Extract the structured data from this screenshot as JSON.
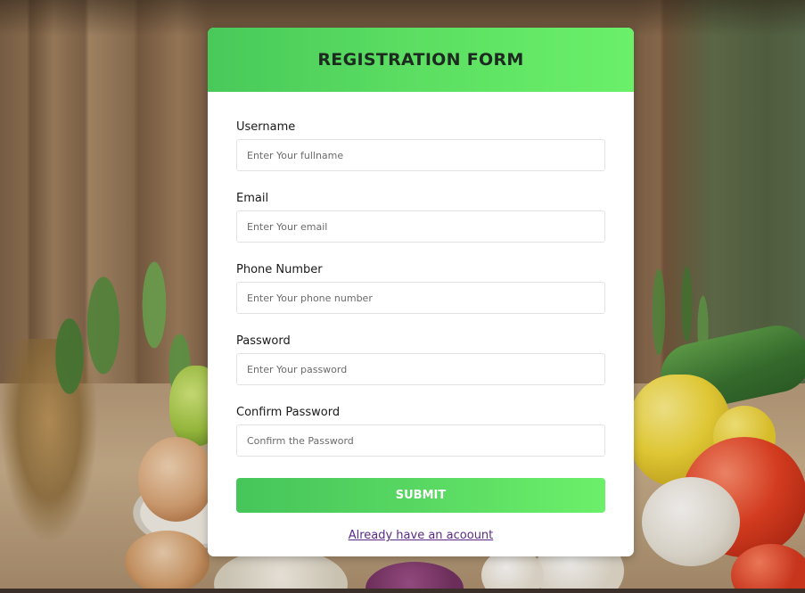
{
  "form": {
    "title": "REGISTRATION FORM",
    "fields": [
      {
        "label": "Username",
        "placeholder": "Enter Your fullname"
      },
      {
        "label": "Email",
        "placeholder": "Enter Your email"
      },
      {
        "label": "Phone Number",
        "placeholder": "Enter Your phone number"
      },
      {
        "label": "Password",
        "placeholder": "Enter Your password"
      },
      {
        "label": "Confirm Password",
        "placeholder": "Confirm the Password"
      }
    ],
    "submit_label": "SUBMIT",
    "login_link": "Already have an acoount"
  },
  "colors": {
    "header_gradient_start": "#48c95a",
    "header_gradient_end": "#6bf06a",
    "link": "#5a2a86"
  }
}
